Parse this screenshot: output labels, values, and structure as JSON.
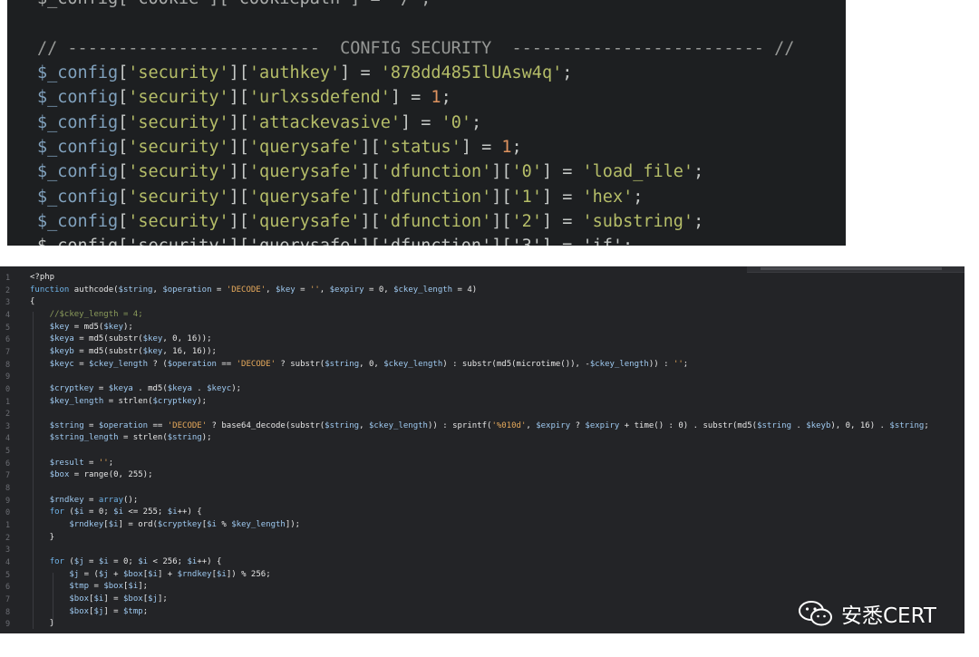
{
  "top_panel": {
    "partial_top": "$_config['cookie']['cookiepath'] = '/';",
    "header_comment": "// -------------------------  CONFIG SECURITY  ------------------------- //",
    "lines": [
      {
        "var": "$_config",
        "keys": [
          "security",
          "authkey"
        ],
        "val": "'878dd485IlUAsw4q'",
        "type": "str"
      },
      {
        "var": "$_config",
        "keys": [
          "security",
          "urlxssdefend"
        ],
        "val": "1",
        "type": "num"
      },
      {
        "var": "$_config",
        "keys": [
          "security",
          "attackevasive"
        ],
        "val": "'0'",
        "type": "str"
      },
      {
        "var": "$_config",
        "keys": [
          "security",
          "querysafe",
          "status"
        ],
        "val": "1",
        "type": "num"
      },
      {
        "var": "$_config",
        "keys": [
          "security",
          "querysafe",
          "dfunction",
          "0"
        ],
        "val": "'load_file'",
        "type": "str"
      },
      {
        "var": "$_config",
        "keys": [
          "security",
          "querysafe",
          "dfunction",
          "1"
        ],
        "val": "'hex'",
        "type": "str"
      },
      {
        "var": "$_config",
        "keys": [
          "security",
          "querysafe",
          "dfunction",
          "2"
        ],
        "val": "'substring'",
        "type": "str"
      }
    ],
    "partial_bottom": "$_config['security']['querysafe']['dfunction']['3'] = 'if';"
  },
  "bottom_panel": {
    "line_numbers": [
      "1",
      "2",
      "3",
      "4",
      "5",
      "6",
      "7",
      "8",
      "9",
      "0",
      "1",
      "2",
      "3",
      "4",
      "5",
      "6",
      "7",
      "8",
      "9",
      "0",
      "1",
      "2",
      "3",
      "4",
      "5",
      "6",
      "7",
      "8",
      "9"
    ],
    "lines": [
      "<?php",
      "function authcode($string, $operation = 'DECODE', $key = '', $expiry = 0, $ckey_length = 4)",
      "{",
      "    //$ckey_length = 4;",
      "    $key = md5($key);",
      "    $keya = md5(substr($key, 0, 16));",
      "    $keyb = md5(substr($key, 16, 16));",
      "    $keyc = $ckey_length ? ($operation == 'DECODE' ? substr($string, 0, $ckey_length) : substr(md5(microtime()), -$ckey_length)) : '';",
      "",
      "    $cryptkey = $keya . md5($keya . $keyc);",
      "    $key_length = strlen($cryptkey);",
      "",
      "    $string = $operation == 'DECODE' ? base64_decode(substr($string, $ckey_length)) : sprintf('%010d', $expiry ? $expiry + time() : 0) . substr(md5($string . $keyb), 0, 16) . $string;",
      "    $string_length = strlen($string);",
      "",
      "    $result = '';",
      "    $box = range(0, 255);",
      "",
      "    $rndkey = array();",
      "    for ($i = 0; $i <= 255; $i++) {",
      "        $rndkey[$i] = ord($cryptkey[$i % $key_length]);",
      "    }",
      "",
      "    for ($j = $i = 0; $i < 256; $i++) {",
      "        $j = ($j + $box[$i] + $rndkey[$i]) % 256;",
      "        $tmp = $box[$i];",
      "        $box[$i] = $box[$j];",
      "        $box[$j] = $tmp;",
      "    }"
    ]
  },
  "watermark": {
    "icon": "wechat-icon",
    "text": "安悉CERT"
  },
  "colors": {
    "top_bg": "#1d1f21",
    "bottom_bg": "#232427",
    "var": "#81a2be",
    "string": "#b5bd68",
    "number": "#de935f",
    "comment": "#969896"
  }
}
